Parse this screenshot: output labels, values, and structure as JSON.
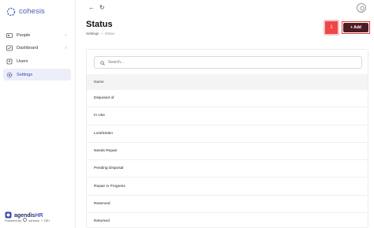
{
  "app": {
    "logo_text": "cohesis"
  },
  "sidebar": {
    "items": [
      {
        "label": "People",
        "icon": "people-icon",
        "chevron": "›"
      },
      {
        "label": "Dashboard",
        "icon": "dashboard-icon",
        "chevron": "›"
      },
      {
        "label": "Users",
        "icon": "users-icon"
      },
      {
        "label": "Settings",
        "icon": "gear-icon",
        "active": true
      }
    ],
    "brand_name": "agendis",
    "brand_suffix": "HR",
    "powered_by": "Powered by",
    "powered_company": "cohesis",
    "powered_extra": "+",
    "powered_tail": "DEI"
  },
  "topbar": {
    "back_icon": "←",
    "refresh_icon": "↻"
  },
  "header": {
    "title": "Status",
    "breadcrumb": [
      "Settings",
      "›",
      "Status"
    ],
    "badge_number": "1",
    "add_label": "+ Add"
  },
  "search": {
    "placeholder": "Search..."
  },
  "table": {
    "column": "Name",
    "rows": [
      "Disposed of",
      "In Use",
      "Lost/Stolen",
      "Needs Repair",
      "Pending Disposal",
      "Repair in Progress",
      "Reserved",
      "Returned"
    ]
  },
  "colors": {
    "accent": "#4a5ab8",
    "add_button": "#4b1d26",
    "badge": "#f04646",
    "active_bg": "#eceef9"
  }
}
